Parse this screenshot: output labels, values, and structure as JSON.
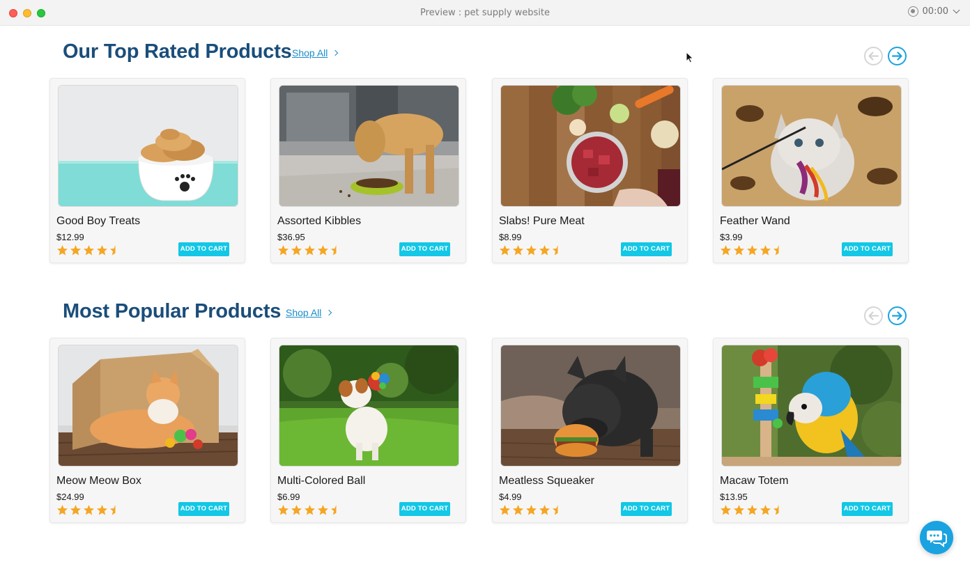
{
  "window": {
    "title": "Preview : pet supply website",
    "timer": "00:00"
  },
  "sections": [
    {
      "title": "Our Top Rated Products",
      "shop_all": "Shop All",
      "products": [
        {
          "name": "Good Boy Treats",
          "price": "$12.99",
          "rating": 4.5,
          "button": "ADD TO CART",
          "image": "bone-treats-in-paw-bowl"
        },
        {
          "name": "Assorted Kibbles",
          "price": "$36.95",
          "rating": 4.5,
          "button": "ADD TO CART",
          "image": "labrador-eating-kibble"
        },
        {
          "name": "Slabs! Pure Meat",
          "price": "$8.99",
          "rating": 4.5,
          "button": "ADD TO CART",
          "image": "raw-meat-bowl-vegetables"
        },
        {
          "name": "Feather Wand",
          "price": "$3.99",
          "rating": 4.5,
          "button": "ADD TO CART",
          "image": "kitten-with-feather-toy"
        }
      ]
    },
    {
      "title": "Most Popular Products",
      "shop_all": "Shop All",
      "products": [
        {
          "name": "Meow Meow Box",
          "price": "$24.99",
          "rating": 4.5,
          "button": "ADD TO CART",
          "image": "cat-in-cardboard-box"
        },
        {
          "name": "Multi-Colored Ball",
          "price": "$6.99",
          "rating": 4.5,
          "button": "ADD TO CART",
          "image": "dog-with-colored-ball"
        },
        {
          "name": "Meatless Squeaker",
          "price": "$4.99",
          "rating": 4.5,
          "button": "ADD TO CART",
          "image": "bulldog-with-burger-toy"
        },
        {
          "name": "Macaw Totem",
          "price": "$13.95",
          "rating": 4.5,
          "button": "ADD TO CART",
          "image": "macaw-with-totem-toy"
        }
      ]
    }
  ],
  "colors": {
    "heading": "#1a4d7a",
    "link": "#1a8cc9",
    "button": "#13c7e6",
    "star": "#f5a623",
    "accent": "#1aa3e0"
  },
  "icons": [
    "close-dot",
    "minimize-dot",
    "maximize-dot",
    "record-icon",
    "chevron-down-icon",
    "chevron-right-icon",
    "arrow-left-icon",
    "arrow-right-icon",
    "star-icon",
    "half-star-icon",
    "chat-icon",
    "pointer-cursor-icon"
  ]
}
